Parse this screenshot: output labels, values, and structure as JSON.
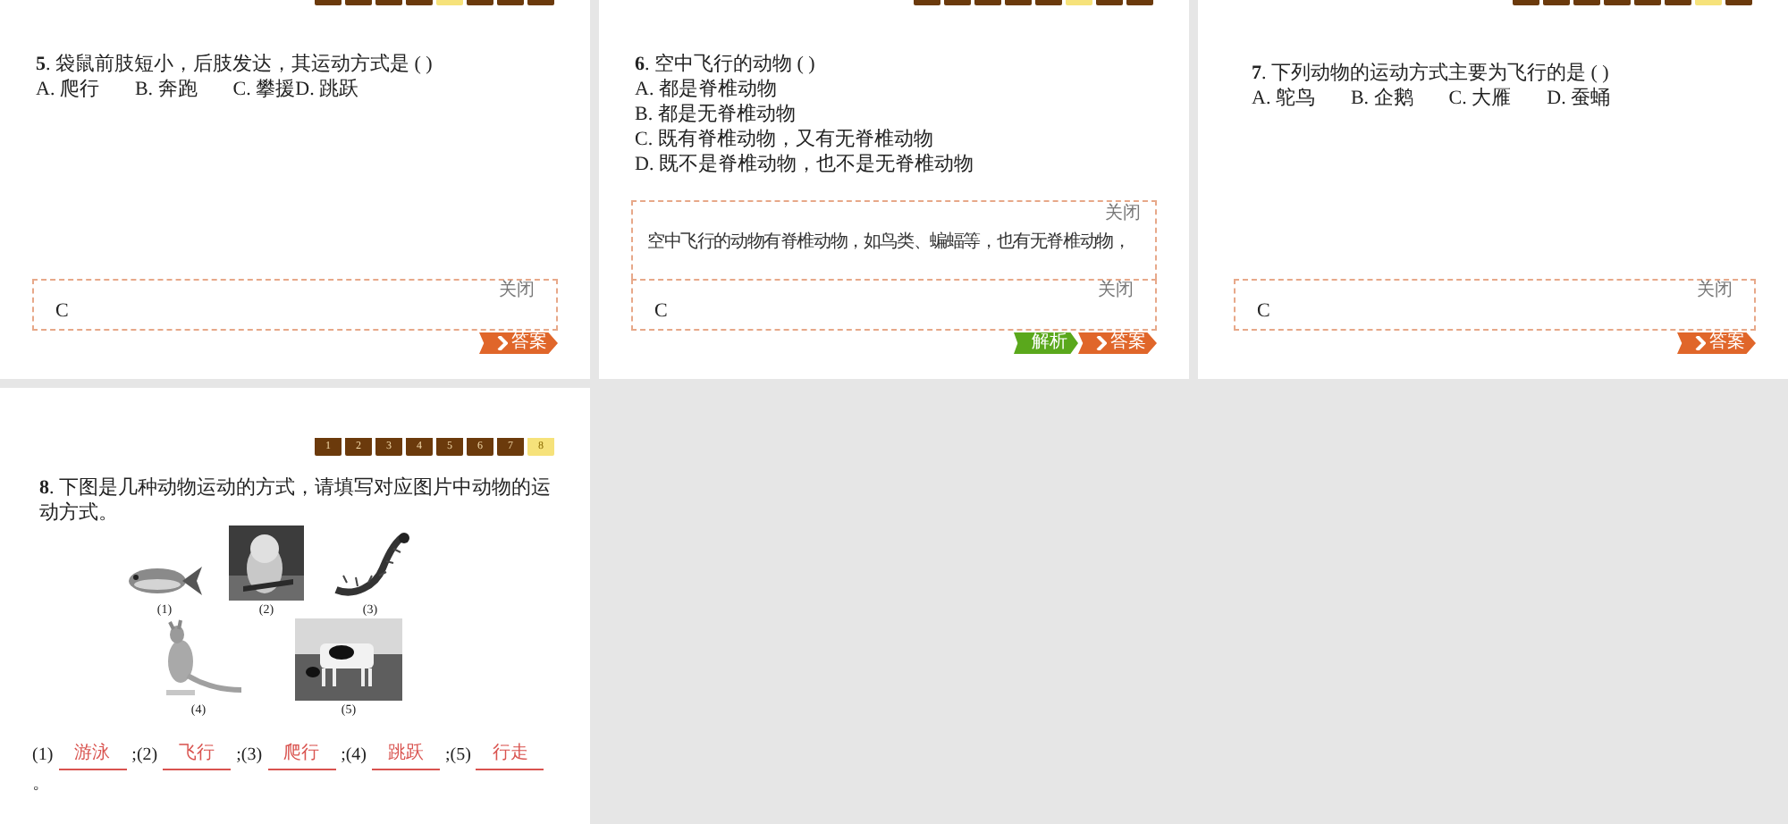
{
  "slides": [
    {
      "nav": [
        {
          "selected": false
        },
        {
          "selected": false
        },
        {
          "selected": false
        },
        {
          "selected": false
        },
        {
          "selected": true
        },
        {
          "selected": false
        },
        {
          "selected": false
        },
        {
          "selected": false
        }
      ],
      "question": "**5**. 袋鼠前肢短小，后肢发达，其运动方式是 ( )",
      "options": {
        "kind": "row",
        "items": [
          "A. 爬行",
          "B. 奔跑",
          "C. 攀援D. 跳跃"
        ]
      },
      "answer_panel": {
        "close": "关闭",
        "answer": "C"
      },
      "buttons": [
        {
          "kind": "answer",
          "label": "答案"
        }
      ]
    },
    {
      "nav": [
        {
          "selected": false
        },
        {
          "selected": false
        },
        {
          "selected": false
        },
        {
          "selected": false
        },
        {
          "selected": false
        },
        {
          "selected": true
        },
        {
          "selected": false
        },
        {
          "selected": false
        }
      ],
      "question": "**6**. 空中飞行的动物 ( )",
      "options": {
        "kind": "column",
        "items": [
          "A. 都是脊椎动物",
          "B. 都是无脊椎动物",
          "C. 既有脊椎动物，又有无脊椎动物",
          "D. 既不是脊椎动物，也不是无脊椎动物"
        ]
      },
      "analysis_panel": {
        "close": "关闭",
        "text": "空中飞行的动物有脊椎动物，如鸟类、蝙蝠等，也有无脊椎动物，"
      },
      "answer_panel": {
        "close": "关闭",
        "answer": "C"
      },
      "buttons": [
        {
          "kind": "analysis",
          "label": "解析"
        },
        {
          "kind": "answer",
          "label": "答案"
        }
      ]
    },
    {
      "nav": [
        {
          "selected": false
        },
        {
          "selected": false
        },
        {
          "selected": false
        },
        {
          "selected": false
        },
        {
          "selected": false
        },
        {
          "selected": false
        },
        {
          "selected": true
        },
        {
          "selected": false
        }
      ],
      "question": "**7**. 下列动物的运动方式主要为飞行的是 ( )",
      "options": {
        "kind": "row",
        "items": [
          "A. 鸵鸟",
          "B. 企鹅",
          "C. 大雁",
          "D. 蚕蛹"
        ]
      },
      "answer_panel": {
        "close": "关闭",
        "answer": "C"
      },
      "buttons": [
        {
          "kind": "answer",
          "label": "答案"
        }
      ]
    }
  ],
  "fill_slide": {
    "nav": [
      {
        "label": "1",
        "selected": false
      },
      {
        "label": "2",
        "selected": false
      },
      {
        "label": "3",
        "selected": false
      },
      {
        "label": "4",
        "selected": false
      },
      {
        "label": "5",
        "selected": false
      },
      {
        "label": "6",
        "selected": false
      },
      {
        "label": "7",
        "selected": false
      },
      {
        "label": "8",
        "selected": true
      }
    ],
    "question": "**8**. 下图是几种动物运动的方式，请填写对应图片中动物的运动方式。",
    "figure_rows": [
      [
        {
          "kind": "picture",
          "caption": "(1)"
        },
        {
          "kind": "picture",
          "caption": "(2)"
        },
        {
          "kind": "picture",
          "caption": "(3)"
        }
      ],
      [
        {
          "kind": "picture",
          "caption": "(4)"
        },
        {
          "kind": "picture",
          "caption": "(5)"
        }
      ]
    ],
    "blanks": [
      {
        "label": "(1)",
        "answer": "游泳"
      },
      {
        "label": ";(2)",
        "answer": "飞行"
      },
      {
        "label": ";(3)",
        "answer": "爬行"
      },
      {
        "label": ";(4)",
        "answer": "跳跃"
      },
      {
        "label": ";(5)",
        "answer": "行走"
      }
    ],
    "end": "。"
  }
}
